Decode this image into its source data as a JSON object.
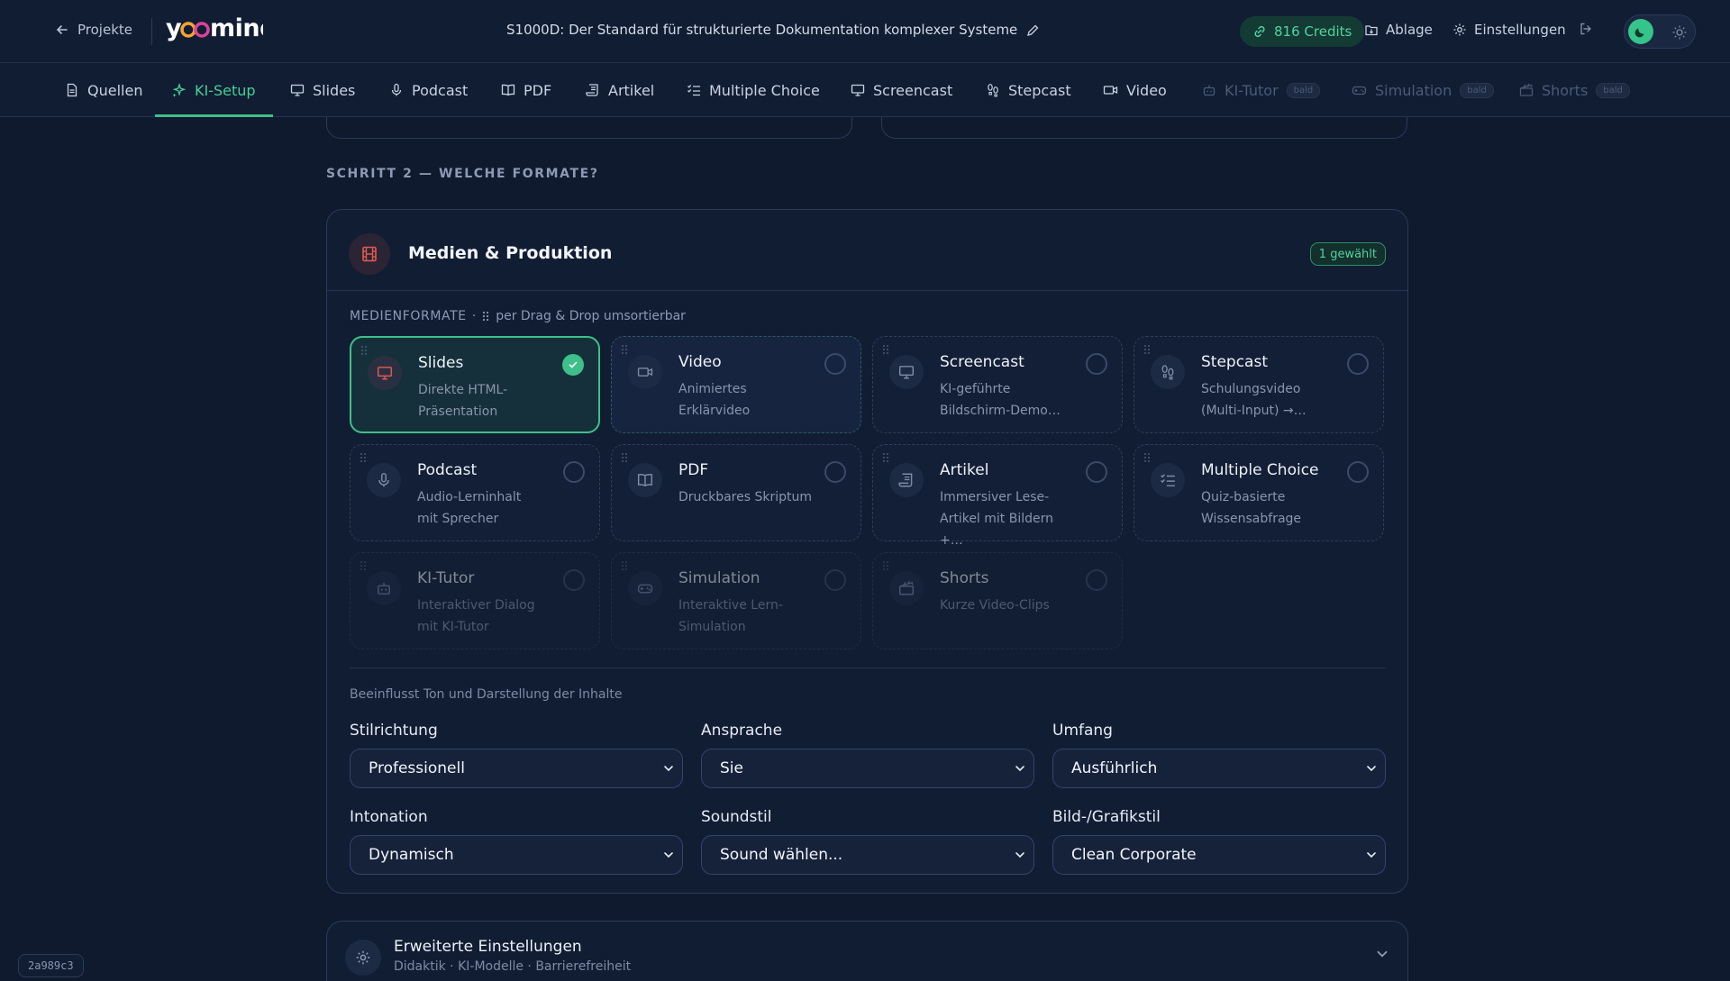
{
  "header": {
    "back_label": "Projekte",
    "logo": "yoomind",
    "project_title": "S1000D: Der Standard für strukturierte Dokumentation komplexer Systeme",
    "credits": "816 Credits",
    "storage_label": "Ablage",
    "settings_label": "Einstellungen",
    "theme": "dark"
  },
  "nav": {
    "tabs": [
      {
        "label": "Quellen",
        "icon": "document-icon",
        "state": "normal"
      },
      {
        "label": "KI-Setup",
        "icon": "sparkle-icon",
        "state": "active"
      },
      {
        "label": "Slides",
        "icon": "presentation-icon",
        "state": "normal"
      },
      {
        "label": "Podcast",
        "icon": "microphone-icon",
        "state": "normal"
      },
      {
        "label": "PDF",
        "icon": "book-icon",
        "state": "normal"
      },
      {
        "label": "Artikel",
        "icon": "scroll-icon",
        "state": "normal"
      },
      {
        "label": "Multiple Choice",
        "icon": "checklist-icon",
        "state": "normal"
      },
      {
        "label": "Screencast",
        "icon": "monitor-icon",
        "state": "normal"
      },
      {
        "label": "Stepcast",
        "icon": "footsteps-icon",
        "state": "normal"
      },
      {
        "label": "Video",
        "icon": "video-icon",
        "state": "normal"
      },
      {
        "label": "KI-Tutor",
        "icon": "robot-icon",
        "state": "disabled",
        "badge": "bald"
      },
      {
        "label": "Simulation",
        "icon": "gamepad-icon",
        "state": "disabled",
        "badge": "bald"
      },
      {
        "label": "Shorts",
        "icon": "clapper-icon",
        "state": "disabled",
        "badge": "bald"
      }
    ]
  },
  "main": {
    "step_label": "SCHRITT 2 — WELCHE FORMATE?",
    "media_panel": {
      "title": "Medien & Produktion",
      "selected_badge": "1 gewählt",
      "formats_caption": "MEDIENFORMATE",
      "formats_hint": "per Drag & Drop umsortierbar",
      "formats": [
        {
          "title": "Slides",
          "desc": "Direkte HTML-Präsentation",
          "icon": "presentation-icon",
          "selected": true,
          "available": true
        },
        {
          "title": "Video",
          "desc": "Animiertes Erklärvideo",
          "icon": "video-icon",
          "selected": false,
          "available": true
        },
        {
          "title": "Screencast",
          "desc": "KI-geführte Bildschirm-Demo…",
          "icon": "monitor-icon",
          "selected": false,
          "available": true
        },
        {
          "title": "Stepcast",
          "desc": "Schulungsvideo (Multi-Input) →…",
          "icon": "footsteps-icon",
          "selected": false,
          "available": true
        },
        {
          "title": "Podcast",
          "desc": "Audio-Lerninhalt mit Sprecher",
          "icon": "microphone-icon",
          "selected": false,
          "available": true
        },
        {
          "title": "PDF",
          "desc": "Druckbares Skriptum",
          "icon": "book-icon",
          "selected": false,
          "available": true
        },
        {
          "title": "Artikel",
          "desc": "Immersiver Lese-Artikel mit Bildern +…",
          "icon": "scroll-icon",
          "selected": false,
          "available": true
        },
        {
          "title": "Multiple Choice",
          "desc": "Quiz-basierte Wissensabfrage",
          "icon": "checklist-icon",
          "selected": false,
          "available": true
        },
        {
          "title": "KI-Tutor",
          "desc": "Interaktiver Dialog mit KI-Tutor",
          "icon": "robot-icon",
          "selected": false,
          "available": false
        },
        {
          "title": "Simulation",
          "desc": "Interaktive Lern-Simulation",
          "icon": "gamepad-icon",
          "selected": false,
          "available": false
        },
        {
          "title": "Shorts",
          "desc": "Kurze Video-Clips",
          "icon": "clapper-icon",
          "selected": false,
          "available": false
        }
      ],
      "influence_note": "Beeinflusst Ton und Darstellung der Inhalte",
      "fields": [
        {
          "label": "Stilrichtung",
          "value": "Professionell"
        },
        {
          "label": "Ansprache",
          "value": "Sie"
        },
        {
          "label": "Umfang",
          "value": "Ausführlich"
        },
        {
          "label": "Intonation",
          "value": "Dynamisch"
        },
        {
          "label": "Soundstil",
          "value": "Sound wählen..."
        },
        {
          "label": "Bild-/Grafikstil",
          "value": "Clean Corporate"
        }
      ]
    },
    "advanced": {
      "title": "Erweiterte Einstellungen",
      "subtitle": "Didaktik · KI-Modelle · Barrierefreiheit"
    }
  },
  "build_tag": "2a989c3",
  "colors": {
    "background": "#0f1a2e",
    "panel": "#111d33",
    "accent_green": "#3fbf89",
    "media_icon_red": "#e05a4f"
  }
}
